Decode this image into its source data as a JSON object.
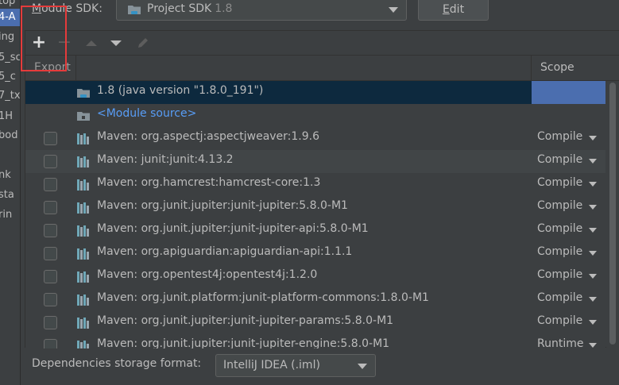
{
  "left_tree": {
    "items": [
      {
        "label": "top",
        "selected": false
      },
      {
        "label": "4-A",
        "selected": true
      },
      {
        "label": "ing",
        "selected": false
      },
      {
        "label": "5_sc",
        "selected": false
      },
      {
        "label": "5_c",
        "selected": false
      },
      {
        "label": "7_tx",
        "selected": false
      },
      {
        "label": "1H",
        "selected": false
      },
      {
        "label": "bod",
        "selected": false
      },
      {
        "label": "nk",
        "selected": false
      },
      {
        "label": "sta",
        "selected": false
      },
      {
        "label": "rin",
        "selected": false
      }
    ]
  },
  "sdk": {
    "label": "Module SDK:",
    "label_mnemonic": "M",
    "label_rest": "odule SDK:",
    "value": "Project SDK",
    "version": "1.8",
    "edit_label": "Edit",
    "edit_mnemonic": "E",
    "edit_rest": "dit"
  },
  "toolbar": {
    "add": "+",
    "remove": "−",
    "icons": [
      "plus-icon",
      "minus-icon",
      "move-up-icon",
      "move-down-icon",
      "edit-pencil-icon"
    ]
  },
  "table": {
    "headers": {
      "export": "Export",
      "scope": "Scope"
    },
    "rows": [
      {
        "label": "1.8 (java version \"1.8.0_191\")",
        "type": "jdk",
        "scope": "",
        "checkbox": false,
        "selected": true
      },
      {
        "label": "<Module source>",
        "type": "module",
        "scope": "",
        "checkbox": false,
        "selected": false
      },
      {
        "label": "Maven: org.aspectj:aspectjweaver:1.9.6",
        "type": "library",
        "scope": "Compile",
        "checkbox": true,
        "selected": false
      },
      {
        "label": "Maven: junit:junit:4.13.2",
        "type": "library",
        "scope": "Compile",
        "checkbox": true,
        "selected": false
      },
      {
        "label": "Maven: org.hamcrest:hamcrest-core:1.3",
        "type": "library",
        "scope": "Compile",
        "checkbox": true,
        "selected": false
      },
      {
        "label": "Maven: org.junit.jupiter:junit-jupiter:5.8.0-M1",
        "type": "library",
        "scope": "Compile",
        "checkbox": true,
        "selected": false
      },
      {
        "label": "Maven: org.junit.jupiter:junit-jupiter-api:5.8.0-M1",
        "type": "library",
        "scope": "Compile",
        "checkbox": true,
        "selected": false
      },
      {
        "label": "Maven: org.apiguardian:apiguardian-api:1.1.1",
        "type": "library",
        "scope": "Compile",
        "checkbox": true,
        "selected": false
      },
      {
        "label": "Maven: org.opentest4j:opentest4j:1.2.0",
        "type": "library",
        "scope": "Compile",
        "checkbox": true,
        "selected": false
      },
      {
        "label": "Maven: org.junit.platform:junit-platform-commons:1.8.0-M1",
        "type": "library",
        "scope": "Compile",
        "checkbox": true,
        "selected": false
      },
      {
        "label": "Maven: org.junit.jupiter:junit-jupiter-params:5.8.0-M1",
        "type": "library",
        "scope": "Compile",
        "checkbox": true,
        "selected": false
      },
      {
        "label": "Maven: org.junit.jupiter:junit-jupiter-engine:5.8.0-M1",
        "type": "library",
        "scope": "Runtime",
        "checkbox": true,
        "selected": false
      }
    ]
  },
  "footer": {
    "label": "Dependencies storage format:",
    "format_value": "IntelliJ IDEA (.iml)"
  },
  "colors": {
    "background": "#3c3f41",
    "selection_dark": "#0d293e",
    "selection_blue": "#4b6eaf",
    "module_source_link": "#589df6",
    "highlight_box": "#e53b3b"
  }
}
